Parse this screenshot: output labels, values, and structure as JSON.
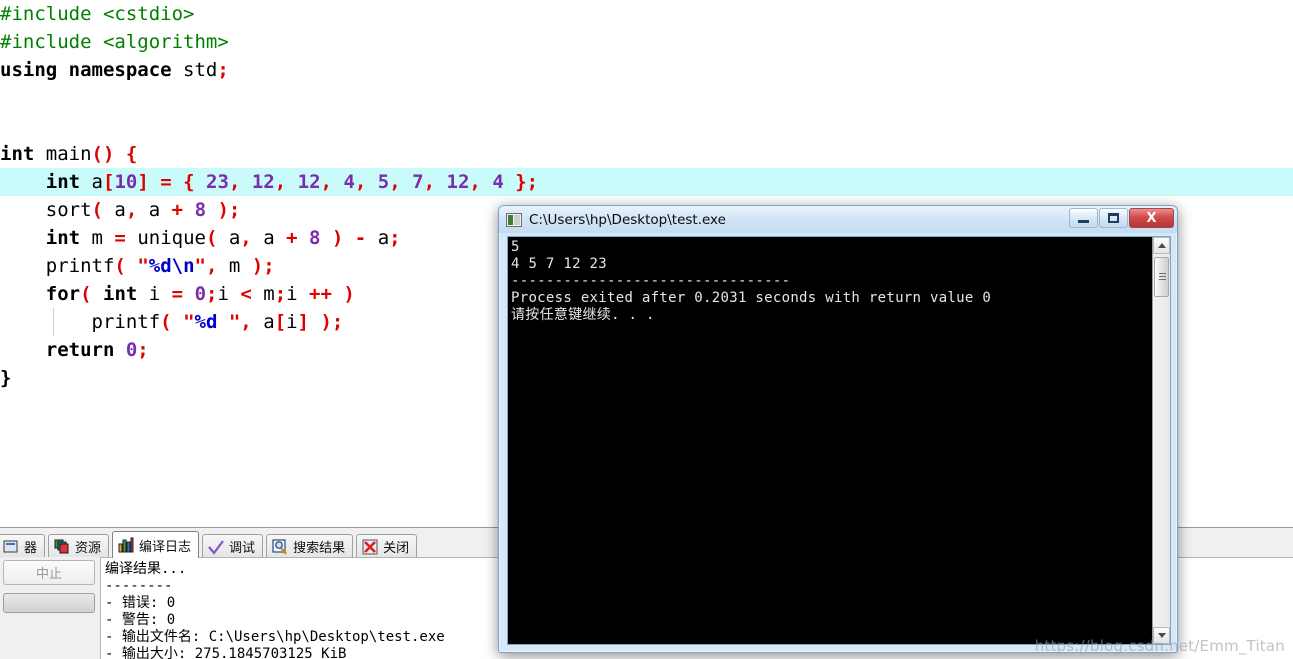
{
  "editor": {
    "highlighted_line_index": 6,
    "lines": [
      [
        {
          "t": "#include ",
          "c": "pre"
        },
        {
          "t": "<cstdio>",
          "c": "pre"
        }
      ],
      [
        {
          "t": "#include ",
          "c": "pre"
        },
        {
          "t": "<algorithm>",
          "c": "pre"
        }
      ],
      [
        {
          "t": "using ",
          "c": "kw"
        },
        {
          "t": "namespace ",
          "c": "kw"
        },
        {
          "t": "std",
          "c": "plain"
        },
        {
          "t": ";",
          "c": "punct"
        }
      ],
      [],
      [],
      [
        {
          "t": "int ",
          "c": "kw"
        },
        {
          "t": "main",
          "c": "plain"
        },
        {
          "t": "()",
          "c": "punct"
        },
        {
          "t": " ",
          "c": "plain"
        },
        {
          "t": "{",
          "c": "punct"
        }
      ],
      [
        {
          "t": "    ",
          "c": "plain"
        },
        {
          "t": "int ",
          "c": "kw"
        },
        {
          "t": "a",
          "c": "plain"
        },
        {
          "t": "[",
          "c": "punct"
        },
        {
          "t": "10",
          "c": "num"
        },
        {
          "t": "]",
          "c": "punct"
        },
        {
          "t": " ",
          "c": "plain"
        },
        {
          "t": "=",
          "c": "op"
        },
        {
          "t": " ",
          "c": "plain"
        },
        {
          "t": "{",
          "c": "punct"
        },
        {
          "t": " ",
          "c": "plain"
        },
        {
          "t": "23",
          "c": "num"
        },
        {
          "t": ",",
          "c": "punct"
        },
        {
          "t": " ",
          "c": "plain"
        },
        {
          "t": "12",
          "c": "num"
        },
        {
          "t": ",",
          "c": "punct"
        },
        {
          "t": " ",
          "c": "plain"
        },
        {
          "t": "12",
          "c": "num"
        },
        {
          "t": ",",
          "c": "punct"
        },
        {
          "t": " ",
          "c": "plain"
        },
        {
          "t": "4",
          "c": "num"
        },
        {
          "t": ",",
          "c": "punct"
        },
        {
          "t": " ",
          "c": "plain"
        },
        {
          "t": "5",
          "c": "num"
        },
        {
          "t": ",",
          "c": "punct"
        },
        {
          "t": " ",
          "c": "plain"
        },
        {
          "t": "7",
          "c": "num"
        },
        {
          "t": ",",
          "c": "punct"
        },
        {
          "t": " ",
          "c": "plain"
        },
        {
          "t": "12",
          "c": "num"
        },
        {
          "t": ",",
          "c": "punct"
        },
        {
          "t": " ",
          "c": "plain"
        },
        {
          "t": "4",
          "c": "num"
        },
        {
          "t": " ",
          "c": "plain"
        },
        {
          "t": "};",
          "c": "punct"
        }
      ],
      [
        {
          "t": "    ",
          "c": "plain"
        },
        {
          "t": "sort",
          "c": "plain"
        },
        {
          "t": "(",
          "c": "punct"
        },
        {
          "t": " a",
          "c": "plain"
        },
        {
          "t": ",",
          "c": "punct"
        },
        {
          "t": " a ",
          "c": "plain"
        },
        {
          "t": "+",
          "c": "op"
        },
        {
          "t": " ",
          "c": "plain"
        },
        {
          "t": "8",
          "c": "num"
        },
        {
          "t": " ",
          "c": "plain"
        },
        {
          "t": ");",
          "c": "punct"
        }
      ],
      [
        {
          "t": "    ",
          "c": "plain"
        },
        {
          "t": "int ",
          "c": "kw"
        },
        {
          "t": "m ",
          "c": "plain"
        },
        {
          "t": "=",
          "c": "op"
        },
        {
          "t": " unique",
          "c": "plain"
        },
        {
          "t": "(",
          "c": "punct"
        },
        {
          "t": " a",
          "c": "plain"
        },
        {
          "t": ",",
          "c": "punct"
        },
        {
          "t": " a ",
          "c": "plain"
        },
        {
          "t": "+",
          "c": "op"
        },
        {
          "t": " ",
          "c": "plain"
        },
        {
          "t": "8",
          "c": "num"
        },
        {
          "t": " ",
          "c": "plain"
        },
        {
          "t": ")",
          "c": "punct"
        },
        {
          "t": " ",
          "c": "plain"
        },
        {
          "t": "-",
          "c": "op"
        },
        {
          "t": " a",
          "c": "plain"
        },
        {
          "t": ";",
          "c": "punct"
        }
      ],
      [
        {
          "t": "    ",
          "c": "plain"
        },
        {
          "t": "printf",
          "c": "plain"
        },
        {
          "t": "(",
          "c": "punct"
        },
        {
          "t": " ",
          "c": "plain"
        },
        {
          "t": "\"",
          "c": "str"
        },
        {
          "t": "%d\\n",
          "c": "esc"
        },
        {
          "t": "\"",
          "c": "str"
        },
        {
          "t": ",",
          "c": "punct"
        },
        {
          "t": " m ",
          "c": "plain"
        },
        {
          "t": ");",
          "c": "punct"
        }
      ],
      [
        {
          "t": "    ",
          "c": "plain"
        },
        {
          "t": "for",
          "c": "kw"
        },
        {
          "t": "(",
          "c": "punct"
        },
        {
          "t": " ",
          "c": "plain"
        },
        {
          "t": "int ",
          "c": "kw"
        },
        {
          "t": "i ",
          "c": "plain"
        },
        {
          "t": "=",
          "c": "op"
        },
        {
          "t": " ",
          "c": "plain"
        },
        {
          "t": "0",
          "c": "num"
        },
        {
          "t": ";",
          "c": "punct"
        },
        {
          "t": "i ",
          "c": "plain"
        },
        {
          "t": "<",
          "c": "op"
        },
        {
          "t": " m",
          "c": "plain"
        },
        {
          "t": ";",
          "c": "punct"
        },
        {
          "t": "i ",
          "c": "plain"
        },
        {
          "t": "++",
          "c": "op"
        },
        {
          "t": " ",
          "c": "plain"
        },
        {
          "t": ")",
          "c": "punct"
        }
      ],
      [
        {
          "t": "        ",
          "c": "plain"
        },
        {
          "t": "printf",
          "c": "plain"
        },
        {
          "t": "(",
          "c": "punct"
        },
        {
          "t": " ",
          "c": "plain"
        },
        {
          "t": "\"",
          "c": "str"
        },
        {
          "t": "%d",
          "c": "esc"
        },
        {
          "t": " \"",
          "c": "str"
        },
        {
          "t": ",",
          "c": "punct"
        },
        {
          "t": " a",
          "c": "plain"
        },
        {
          "t": "[",
          "c": "punct"
        },
        {
          "t": "i",
          "c": "plain"
        },
        {
          "t": "]",
          "c": "punct"
        },
        {
          "t": " ",
          "c": "plain"
        },
        {
          "t": ");",
          "c": "punct"
        }
      ],
      [
        {
          "t": "    ",
          "c": "plain"
        },
        {
          "t": "return ",
          "c": "kw"
        },
        {
          "t": "0",
          "c": "num"
        },
        {
          "t": ";",
          "c": "punct"
        }
      ],
      [
        {
          "t": "}",
          "c": "kw"
        }
      ]
    ]
  },
  "console_window": {
    "title": "C:\\Users\\hp\\Desktop\\test.exe",
    "icon": "console-app-icon",
    "buttons": {
      "minimize": "minimize-button",
      "maximize": "maximize-button",
      "close_label": "X"
    },
    "output_lines": [
      "5",
      "4 5 7 12 23",
      "--------------------------------",
      "Process exited after 0.2031 seconds with return value 0",
      "请按任意键继续. . ."
    ],
    "scrollbar": {
      "up": "▲",
      "down": "▼"
    }
  },
  "bottom_panel": {
    "tabs": [
      {
        "label": "器",
        "icon": "compiler-icon",
        "active": false,
        "cut": true
      },
      {
        "label": "资源",
        "icon": "resources-icon",
        "active": false,
        "cut": false
      },
      {
        "label": "编译日志",
        "icon": "compile-log-icon",
        "active": true,
        "cut": false
      },
      {
        "label": "调试",
        "icon": "debug-check-icon",
        "active": false,
        "cut": false
      },
      {
        "label": "搜索结果",
        "icon": "search-results-icon",
        "active": false,
        "cut": false
      },
      {
        "label": "关闭",
        "icon": "close-x-icon",
        "active": false,
        "cut": false
      }
    ],
    "abort_button_label": "中止",
    "log_lines": [
      "编译结果...",
      "--------",
      "- 错误: 0",
      "- 警告: 0",
      "- 输出文件名: C:\\Users\\hp\\Desktop\\test.exe",
      "- 输出大小: 275.1845703125 KiB"
    ]
  },
  "watermark": {
    "text": "https://blog.csdn.net/Emm_Titan"
  },
  "colors": {
    "preprocessor_green": "#008000",
    "punct_red": "#e00000",
    "number_purple": "#7a2dad",
    "escape_blue": "#0000cc",
    "highlight_line": "#c9fbfb",
    "console_bg": "#000000",
    "titlebar_blue": "#cfe3f6",
    "close_red": "#cf4a4a"
  }
}
